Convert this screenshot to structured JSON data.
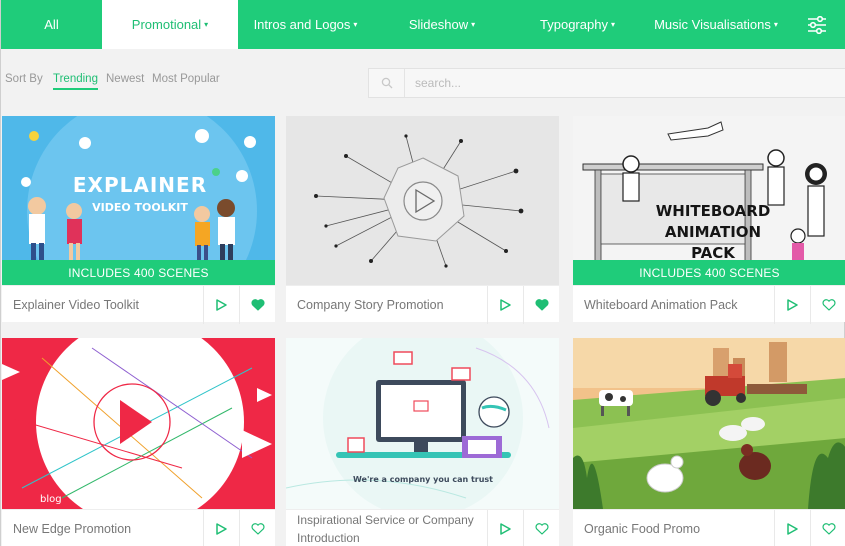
{
  "colors": {
    "accent": "#1fcc7a",
    "accent_text": "#1fbe74",
    "heart_filled": "#1fbe74",
    "tag_red": "#ef2846"
  },
  "nav": {
    "items": [
      {
        "label": "All",
        "caret": ""
      },
      {
        "label": "Promotional",
        "caret": "▾",
        "active": true
      },
      {
        "label": "Intros and Logos",
        "caret": "▾"
      },
      {
        "label": "Slideshow",
        "caret": "▾"
      },
      {
        "label": "Typography",
        "caret": "▾"
      },
      {
        "label": "Music Visualisations",
        "caret": "▾"
      }
    ],
    "settings_icon": "sliders-icon"
  },
  "sort": {
    "label": "Sort By",
    "options": [
      {
        "label": "Trending",
        "active": true
      },
      {
        "label": "Newest"
      },
      {
        "label": "Most Popular"
      }
    ]
  },
  "search": {
    "placeholder": "search...",
    "value": "",
    "icon": "search-icon"
  },
  "cards": [
    {
      "title": "Explainer Video Toolkit",
      "banner": "INCLUDES 400 SCENES",
      "favorited": true,
      "thumb": {
        "headline": "EXPLAINER",
        "subline": "VIDEO TOOLKIT"
      }
    },
    {
      "title": "Company Story Promotion",
      "banner": "",
      "favorited": true
    },
    {
      "title": "Whiteboard Animation Pack",
      "banner": "INCLUDES 400 SCENES",
      "favorited": false,
      "thumb": {
        "line1": "WHITEBOARD",
        "line2": "ANIMATION",
        "line3": "PACK"
      }
    },
    {
      "title": "New Edge Promotion",
      "banner": "",
      "favorited": false,
      "thumb": {
        "tag": "blog"
      }
    },
    {
      "title": "Inspirational Service or Company Introduction",
      "banner": "",
      "favorited": false,
      "thumb": {
        "caption": "We're a company you can trust"
      }
    },
    {
      "title": "Organic Food Promo",
      "banner": "",
      "favorited": false
    }
  ]
}
